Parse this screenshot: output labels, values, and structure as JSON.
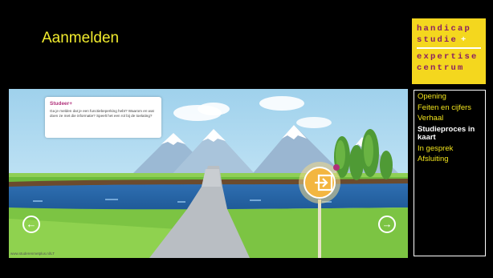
{
  "slide": {
    "title": "Aanmelden"
  },
  "logo": {
    "line1": "handicap",
    "line2": "studie",
    "line2_plus": "+",
    "line3": "expertise",
    "line4": "centrum"
  },
  "menu": {
    "items": [
      {
        "label": "Opening",
        "active": false
      },
      {
        "label": "Feiten en cijfers",
        "active": false
      },
      {
        "label": "Verhaal",
        "active": false
      },
      {
        "label": "Studieproces in kaart",
        "active": true
      },
      {
        "label": "In gesprek",
        "active": false
      },
      {
        "label": "Afsluiting",
        "active": false
      }
    ]
  },
  "scene": {
    "popup_title": "Studeer+",
    "popup_text": "Ga je melden dat je een functiebeperking hebt? Waarom en wat doen ze met die informatie? Speelt het een rol bij de toelating?",
    "url": "www.studerenmetplus.nl/LT",
    "prev_icon": "arrow-left-icon",
    "next_icon": "arrow-right-icon",
    "sign_icon": "login-sign-icon"
  },
  "colors": {
    "title": "#f2ec2e",
    "menu": "#f2e41d",
    "logo_bg": "#f4d71e",
    "logo_text": "#8a1e63"
  }
}
